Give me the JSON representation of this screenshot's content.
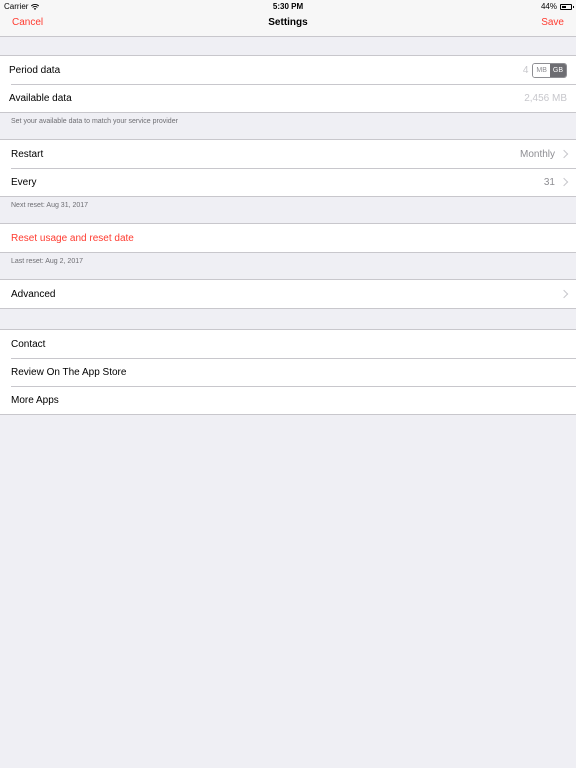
{
  "status_bar": {
    "carrier": "Carrier",
    "time": "5:30 PM",
    "battery": "44%",
    "battery_level": 0.44
  },
  "nav": {
    "cancel": "Cancel",
    "title": "Settings",
    "save": "Save"
  },
  "data_section": {
    "period_label": "Period data",
    "period_value": "4",
    "unit_mb": "MB",
    "unit_gb": "GB",
    "available_label": "Available data",
    "available_value": "2,456 MB",
    "footer": "Set your available data to match your service provider"
  },
  "reset_section": {
    "restart_label": "Restart",
    "restart_value": "Monthly",
    "every_label": "Every",
    "every_value": "31",
    "footer": "Next reset: Aug 31, 2017"
  },
  "usage_section": {
    "reset_label": "Reset usage and reset date",
    "footer": "Last reset: Aug 2, 2017"
  },
  "advanced_section": {
    "label": "Advanced"
  },
  "links_section": {
    "contact": "Contact",
    "review": "Review On The App Store",
    "more_apps": "More Apps"
  },
  "colors": {
    "accent": "#ff3b30",
    "background": "#efeff4"
  }
}
